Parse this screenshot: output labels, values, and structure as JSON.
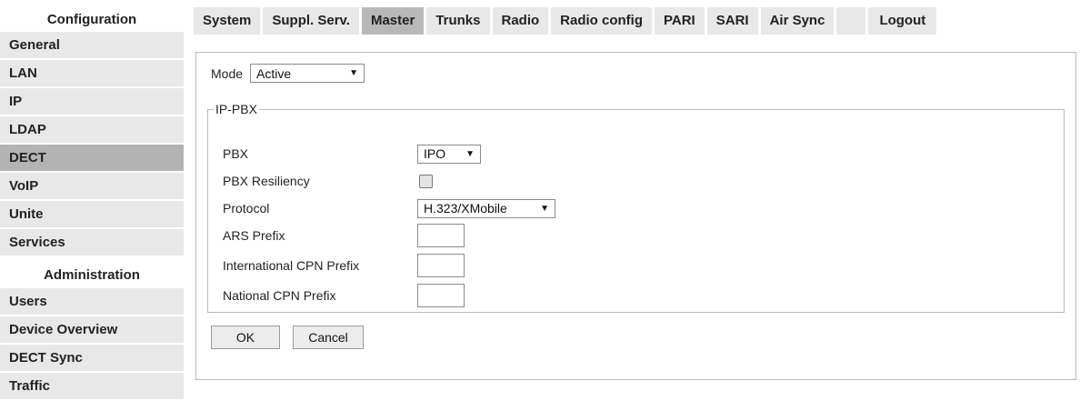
{
  "sidebar": {
    "config_heading": "Configuration",
    "config_items": [
      {
        "label": "General"
      },
      {
        "label": "LAN"
      },
      {
        "label": "IP"
      },
      {
        "label": "LDAP"
      },
      {
        "label": "DECT",
        "active": true
      },
      {
        "label": "VoIP"
      },
      {
        "label": "Unite"
      },
      {
        "label": "Services"
      }
    ],
    "admin_heading": "Administration",
    "admin_items": [
      {
        "label": "Users"
      },
      {
        "label": "Device Overview"
      },
      {
        "label": "DECT Sync"
      },
      {
        "label": "Traffic"
      }
    ]
  },
  "topnav": {
    "tabs": [
      {
        "label": "System"
      },
      {
        "label": "Suppl. Serv."
      },
      {
        "label": "Master",
        "active": true
      },
      {
        "label": "Trunks"
      },
      {
        "label": "Radio"
      },
      {
        "label": "Radio config"
      },
      {
        "label": "PARI"
      },
      {
        "label": "SARI"
      },
      {
        "label": "Air Sync"
      }
    ],
    "logout_label": "Logout"
  },
  "form": {
    "mode_label": "Mode",
    "mode_value": "Active",
    "fieldset_legend": "IP-PBX",
    "pbx_label": "PBX",
    "pbx_value": "IPO",
    "resiliency_label": "PBX Resiliency",
    "resiliency_checked": false,
    "protocol_label": "Protocol",
    "protocol_value": "H.323/XMobile",
    "ars_label": "ARS Prefix",
    "ars_value": "",
    "intl_label": "International CPN Prefix",
    "intl_value": "",
    "national_label": "National CPN Prefix",
    "national_value": "",
    "ok_label": "OK",
    "cancel_label": "Cancel"
  },
  "icons": {
    "dropdown_arrow": "▼"
  },
  "colors": {
    "tab_bg": "#e8e8e8",
    "tab_active_bg": "#b8b8b8",
    "border": "#b8b8b8"
  }
}
